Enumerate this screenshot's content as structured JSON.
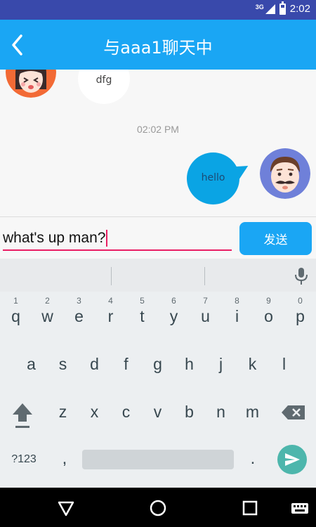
{
  "status_bar": {
    "network": "3G",
    "time": "2:02"
  },
  "header": {
    "title": "与aaa1聊天中"
  },
  "chat": {
    "messages": [
      {
        "side": "left",
        "text": "dfg"
      },
      {
        "side": "right",
        "text": "hello"
      }
    ],
    "timestamp": "02:02 PM"
  },
  "composer": {
    "input_value": "what's up man?",
    "send_label": "发送"
  },
  "keyboard": {
    "row1": [
      {
        "key": "q",
        "hint": "1"
      },
      {
        "key": "w",
        "hint": "2"
      },
      {
        "key": "e",
        "hint": "3"
      },
      {
        "key": "r",
        "hint": "4"
      },
      {
        "key": "t",
        "hint": "5"
      },
      {
        "key": "y",
        "hint": "6"
      },
      {
        "key": "u",
        "hint": "7"
      },
      {
        "key": "i",
        "hint": "8"
      },
      {
        "key": "o",
        "hint": "9"
      },
      {
        "key": "p",
        "hint": "0"
      }
    ],
    "row2": [
      "a",
      "s",
      "d",
      "f",
      "g",
      "h",
      "j",
      "k",
      "l"
    ],
    "row3": [
      "z",
      "x",
      "c",
      "v",
      "b",
      "n",
      "m"
    ],
    "symbols_label": "?123",
    "comma": ",",
    "period": "."
  },
  "colors": {
    "status_bar": "#3949ab",
    "header": "#1aa6f4",
    "outgoing_bubble": "#0aa4e4",
    "input_underline": "#e91e63",
    "enter_key": "#4db6ac"
  },
  "icons": {
    "back": "chevron-left-icon",
    "mic": "microphone-icon",
    "shift": "shift-icon",
    "backspace": "backspace-icon",
    "enter": "send-arrow-icon",
    "nav_back": "triangle-back-icon",
    "nav_home": "circle-home-icon",
    "nav_recents": "square-recents-icon",
    "nav_keyboard": "keyboard-icon"
  }
}
